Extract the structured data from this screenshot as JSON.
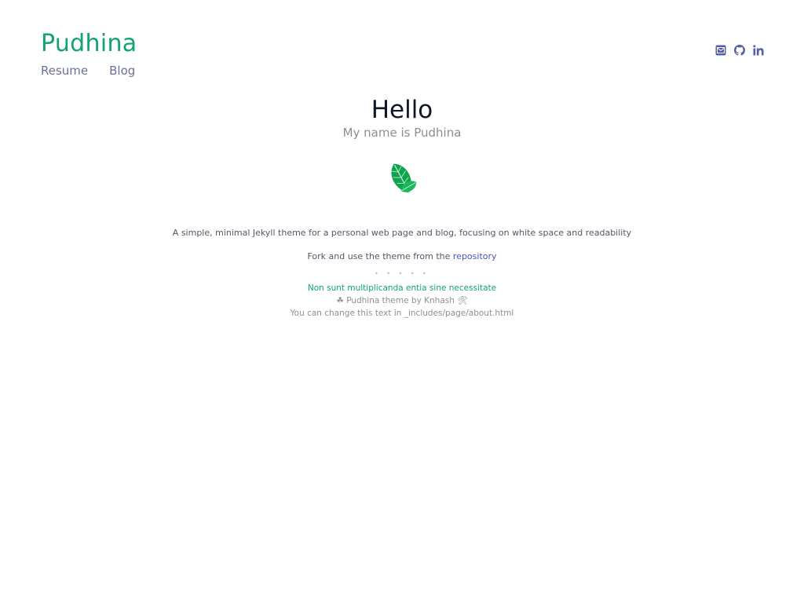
{
  "header": {
    "site_title": "Pudhina",
    "nav": [
      {
        "label": "Resume"
      },
      {
        "label": "Blog"
      }
    ],
    "social_icons": [
      "email-icon",
      "github-icon",
      "linkedin-icon"
    ]
  },
  "main": {
    "heading": "Hello",
    "subtitle": "My name is Pudhina",
    "image_icon": "mint-leaf-icon",
    "description": "A simple, minimal Jekyll theme for a personal web page and blog, focusing on white space and readability",
    "fork_prefix": "Fork and use the theme from the",
    "fork_link": "repository",
    "dots": "• • • • •",
    "quote": "Non sunt multiplicanda entia sine necessitate",
    "credit": "☘ Pudhina theme by Knhash 🛠",
    "note": "You can change this text in _includes/page/about.html"
  },
  "colors": {
    "brand": "#11a373",
    "nav": "#6c6f9c",
    "link": "#4b53b6",
    "icon": "#5561a6"
  }
}
